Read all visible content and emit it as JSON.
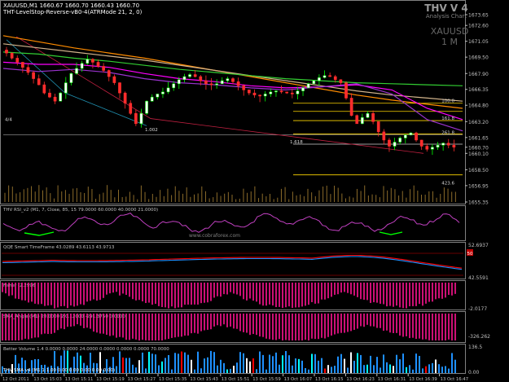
{
  "header": {
    "symbol_line": "XAUUSD,M1  1660.67 1660.70 1660.43 1660.70",
    "indicator_line": "THT-LevelStop-Reverse-vB0-4(ATRMode 21, 2, 0)",
    "brand_title": "THV V 4",
    "brand_subtitle": "Analysis Chart",
    "watermark_symbol": "XAUUSD",
    "watermark_tf": "1 M"
  },
  "colors": {
    "background": "#000000",
    "axis": "#c0c0c0",
    "bull_candle": "#00ff00",
    "bear_candle": "#ff2d2d",
    "ma_orange": "#ff8c00",
    "ma_tan": "#d2b48c",
    "ma_green": "#32cd32",
    "ma_magenta": "#ff00ff",
    "ma_purple": "#9932cc",
    "ma_blue": "#1e90ff",
    "fib_line": "#ffd700",
    "rsi_line": "#c040c0",
    "qqe_red": "#ff0000",
    "qqe_blue": "#1e90ff",
    "fisher_bar": "#ff1493",
    "volume_blue": "#1e90ff",
    "volume_white": "#ffffff",
    "volume_cyan": "#00ffff"
  },
  "chart_data": {
    "type": "candlestick",
    "symbol": "XAUUSD",
    "timeframe": "M1",
    "price_axis": {
      "labels": [
        "1673.65",
        "1672.60",
        "1671.05",
        "1669.50",
        "1667.90",
        "1666.35",
        "1664.80",
        "1663.20",
        "1661.65",
        "1660.70",
        "1660.10",
        "1658.50",
        "1656.95",
        "1655.35"
      ],
      "ylim": [
        1655.35,
        1673.65
      ]
    },
    "time_axis": {
      "labels": [
        "12 Oct 2011",
        "13 Oct 15:03",
        "13 Oct 15:11",
        "13 Oct 15:19",
        "13 Oct 15:27",
        "13 Oct 15:35",
        "13 Oct 15:43",
        "13 Oct 15:51",
        "13 Oct 15:59",
        "13 Oct 16:07",
        "13 Oct 16:15",
        "13 Oct 16:23",
        "13 Oct 16:31",
        "13 Oct 16:39",
        "13 Oct 16:47"
      ]
    },
    "close_trend": [
      1669.9,
      1669.4,
      1669.0,
      1668.5,
      1668.0,
      1667.4,
      1666.8,
      1666.0,
      1665.6,
      1665.2,
      1666.0,
      1667.0,
      1667.9,
      1668.4,
      1668.9,
      1669.3,
      1669.0,
      1668.6,
      1668.2,
      1667.6,
      1667.0,
      1666.0,
      1665.0,
      1664.0,
      1663.0,
      1664.0,
      1665.2,
      1665.6,
      1665.9,
      1666.1,
      1666.5,
      1666.9,
      1667.3,
      1667.6,
      1667.8,
      1667.6,
      1667.2,
      1666.9,
      1666.8,
      1666.9,
      1667.2,
      1667.4,
      1667.1,
      1666.7,
      1666.3,
      1666.0,
      1665.8,
      1665.7,
      1665.9,
      1666.1,
      1666.2,
      1666.1,
      1666.0,
      1665.9,
      1666.2,
      1666.5,
      1666.9,
      1667.2,
      1667.5,
      1667.7,
      1667.6,
      1667.3,
      1667.0,
      1665.5,
      1663.8,
      1663.0,
      1663.6,
      1664.0,
      1663.2,
      1662.2,
      1661.4,
      1660.8,
      1661.2,
      1661.6,
      1661.9,
      1662.1,
      1661.4,
      1660.8,
      1660.5,
      1660.7,
      1660.9,
      1661.1,
      1660.9,
      1660.7
    ],
    "moving_averages": [
      {
        "color_key": "ma_orange",
        "values": [
          1671.6,
          1671.0,
          1670.4,
          1669.9,
          1669.4,
          1668.8,
          1668.2,
          1667.6,
          1667.0,
          1666.4,
          1665.8,
          1665.3,
          1664.9,
          1664.5
        ]
      },
      {
        "color_key": "ma_tan",
        "values": [
          1670.8,
          1670.4,
          1670.0,
          1669.6,
          1669.2,
          1668.7,
          1668.2,
          1667.7,
          1667.2,
          1666.7,
          1666.2,
          1665.8,
          1665.5,
          1665.2
        ]
      },
      {
        "color_key": "ma_green",
        "values": [
          1670.0,
          1669.8,
          1669.4,
          1669.1,
          1668.7,
          1668.3,
          1668.0,
          1667.7,
          1667.4,
          1667.2,
          1667.0,
          1666.9,
          1666.8,
          1666.7
        ]
      },
      {
        "color_key": "ma_magenta",
        "values": [
          1669.0,
          1668.8,
          1668.8,
          1668.5,
          1667.9,
          1667.4,
          1667.1,
          1666.7,
          1666.5,
          1666.6,
          1666.8,
          1666.3,
          1664.5,
          1663.4
        ]
      },
      {
        "color_key": "ma_purple",
        "values": [
          1668.4,
          1668.1,
          1668.3,
          1668.0,
          1667.4,
          1667.0,
          1666.8,
          1666.5,
          1666.3,
          1666.6,
          1666.9,
          1665.9,
          1663.4,
          1662.3
        ]
      }
    ],
    "level_labels": [
      "4/4",
      "1.002",
      "1.618",
      "100.0",
      "161.8",
      "261.8",
      "423.6"
    ],
    "indicators": [
      {
        "name": "THV RSI_v2",
        "params": "(M1, 7, Close, 85, 15 79.0000 60.0000 40.0000 21.0000)",
        "levels": [],
        "watermark": "www.cobraforex.com"
      },
      {
        "name": "QQE Smart TimeFrame",
        "params": "43.0289 43.6113 43.9713",
        "levels": [
          "52.6937",
          "42.5591"
        ],
        "badge": "50"
      },
      {
        "name": "Fisher",
        "params": "-2.2996",
        "levels": [
          "-2.0177"
        ]
      },
      {
        "name": "SMA_Angle",
        "params": "(M1) 20.0000 2.0.12000 -291.3750 0.0000",
        "levels": [
          "-326.262"
        ]
      },
      {
        "name": "Better Volume 1.4",
        "params": "0.0000 0.0000 24.0000 0.0000 0.0000 0.0000 70.0000",
        "levels": [
          "136.5",
          "0.00"
        ]
      }
    ],
    "footer_text": "THV SMA v4 (M1 1:1.00 0.00 0.00 0.00 0.00 0.00)"
  }
}
